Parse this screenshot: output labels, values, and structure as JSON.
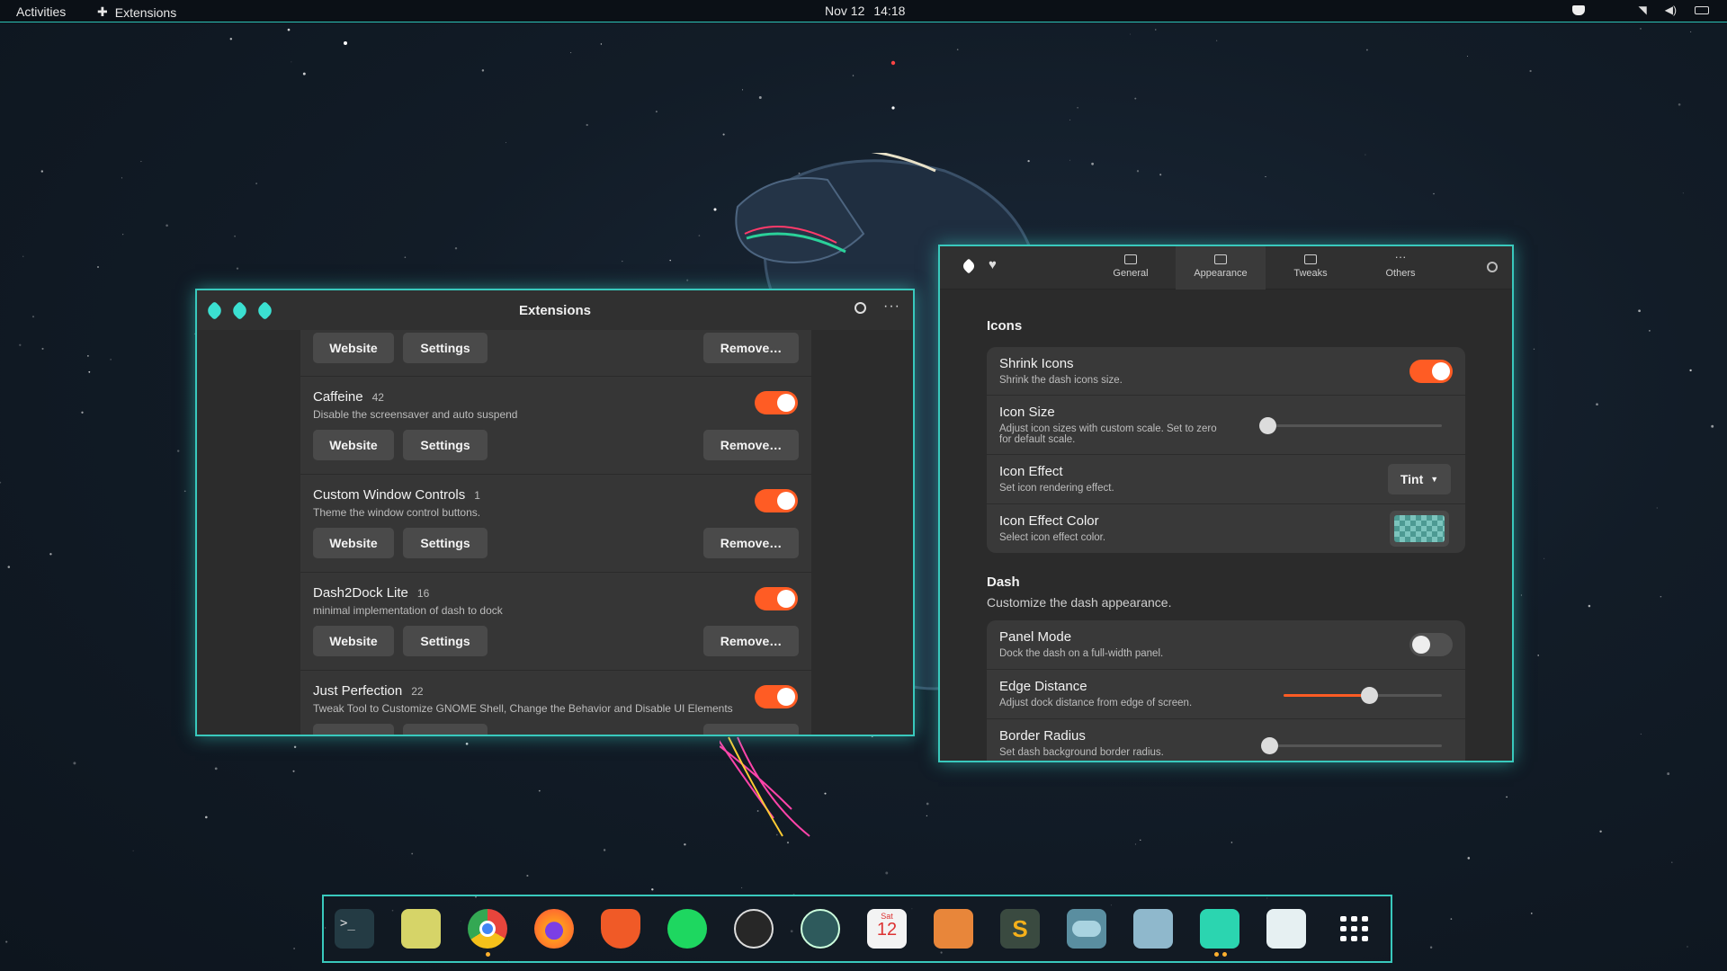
{
  "topbar": {
    "activities": "Activities",
    "app_name": "Extensions",
    "date": "Nov 12",
    "time": "14:18"
  },
  "extensions_window": {
    "title": "Extensions",
    "top_row": {
      "website": "Website",
      "settings": "Settings",
      "remove": "Remove…"
    },
    "items": [
      {
        "name": "Caffeine",
        "count": "42",
        "desc": "Disable the screensaver and auto suspend",
        "enabled": true,
        "website": "Website",
        "settings": "Settings",
        "remove": "Remove…"
      },
      {
        "name": "Custom Window Controls",
        "count": "1",
        "desc": "Theme the window control buttons.",
        "enabled": true,
        "website": "Website",
        "settings": "Settings",
        "remove": "Remove…"
      },
      {
        "name": "Dash2Dock Lite",
        "count": "16",
        "desc": "minimal implementation of dash to dock",
        "enabled": true,
        "website": "Website",
        "settings": "Settings",
        "remove": "Remove…"
      },
      {
        "name": "Just Perfection",
        "count": "22",
        "desc": "Tweak Tool to Customize GNOME Shell, Change the Behavior and Disable UI Elements",
        "enabled": true
      }
    ]
  },
  "prefs_window": {
    "tabs": [
      {
        "label": "General",
        "icon": "sliders-icon"
      },
      {
        "label": "Appearance",
        "icon": "display-icon",
        "active": true
      },
      {
        "label": "Tweaks",
        "icon": "tweaks-icon"
      },
      {
        "label": "Others",
        "icon": "ellipsis-icon"
      }
    ],
    "icons_section": {
      "title": "Icons",
      "rows": {
        "shrink": {
          "title": "Shrink Icons",
          "sub": "Shrink the dash icons size.",
          "enabled": true
        },
        "size": {
          "title": "Icon Size",
          "sub1": "Adjust icon sizes with custom scale. Set to zero",
          "sub2": "for default scale.",
          "value": 0
        },
        "effect": {
          "title": "Icon Effect",
          "sub": "Set icon rendering effect.",
          "value": "Tint"
        },
        "color": {
          "title": "Icon Effect Color",
          "sub": "Select icon effect color."
        }
      }
    },
    "dash_section": {
      "title": "Dash",
      "subtitle": "Customize the dash appearance.",
      "rows": {
        "panel": {
          "title": "Panel Mode",
          "sub": "Dock the dash on a full-width panel.",
          "enabled": false
        },
        "edge": {
          "title": "Edge Distance",
          "sub": "Adjust dock distance from edge of screen.",
          "value": 0.54
        },
        "radius": {
          "title": "Border Radius",
          "sub": "Set dash background border radius.",
          "value": 0
        }
      }
    }
  },
  "dock": {
    "apps": [
      "terminal-icon",
      "files-icon",
      "chrome-icon",
      "firefox-icon",
      "brave-icon",
      "spotify-icon",
      "obs-icon",
      "clock-icon",
      "calendar-icon",
      "vlc-icon",
      "sublime-icon",
      "toggle-icon",
      "settings-icon",
      "extensions-icon",
      "trash-icon",
      "app-grid-icon"
    ],
    "calendar_day": "Sat",
    "calendar_date": "12"
  },
  "colors": {
    "accent": "#39c9bd",
    "toggle_on": "#ff5c24"
  }
}
